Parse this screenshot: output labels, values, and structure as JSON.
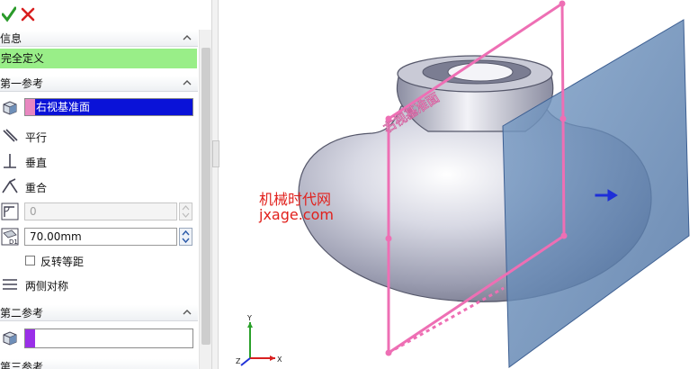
{
  "toolbar": {
    "ok_icon": "check-icon",
    "cancel_icon": "x-icon"
  },
  "sections": {
    "info": {
      "title": "信息",
      "message": "完全定义"
    },
    "ref1": {
      "title": "第一参考",
      "selection": "右视基准面",
      "constraints": [
        "平行",
        "垂直",
        "重合"
      ],
      "angle_value": "0",
      "distance_value": "70.00mm",
      "flip_label": "反转等距",
      "symmetric_label": "两侧对称"
    },
    "ref2": {
      "title": "第二参考"
    },
    "ref3": {
      "title": "第三参考"
    }
  },
  "viewport": {
    "plane_label": "右视基准面",
    "watermark_line1": "机械时代网",
    "watermark_line2": "jxage.com",
    "axes": {
      "x": "X",
      "y": "Y",
      "z": "Z"
    }
  },
  "colors": {
    "ok": "#2a9a2a",
    "cancel": "#d81e1e",
    "status_green": "#99ee88",
    "selection_blue": "#0a12d8",
    "ref1_swatch": "#e887c0",
    "ref2_swatch": "#9a2fe8",
    "plane_pink": "#ee6fb4",
    "new_plane_blue": "#5a82b4",
    "watermark_red": "#e1201c"
  }
}
